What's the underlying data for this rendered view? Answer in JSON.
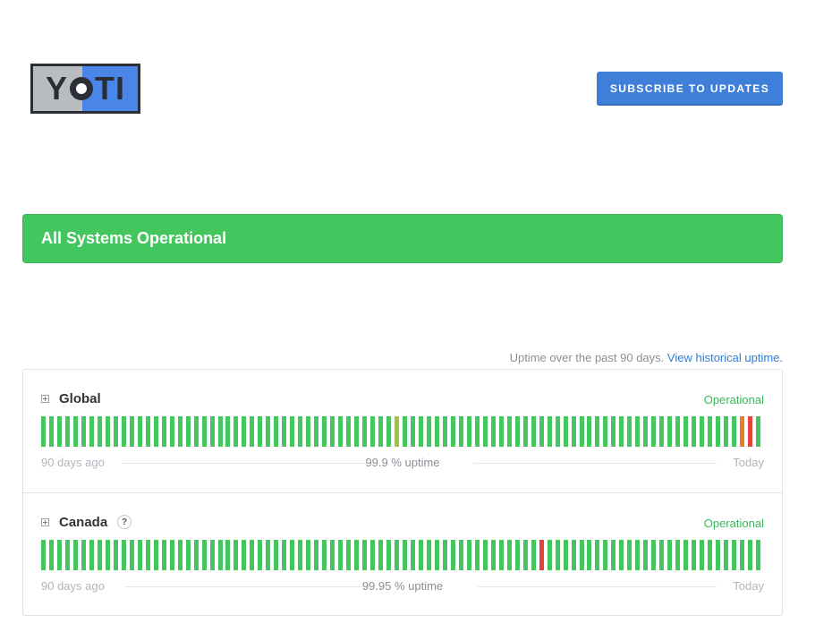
{
  "logo": {
    "text_left": "Y",
    "text_right": "TI",
    "alt": "YOTI"
  },
  "header": {
    "subscribe_label": "SUBSCRIBE TO UPDATES"
  },
  "banner": {
    "text": "All Systems Operational"
  },
  "uptime_note": {
    "text": "Uptime over the past 90 days.",
    "link": "View historical uptime."
  },
  "colors": {
    "operational": "#43c65e",
    "minor": "#a4c03c",
    "partial": "#e67e22",
    "major": "#e0443a",
    "accent": "#3f7fd9"
  },
  "components": [
    {
      "name": "Global",
      "status": "Operational",
      "has_help": false,
      "days_ago_label": "90 days ago",
      "uptime_label": "99.9 % uptime",
      "today_label": "Today",
      "incident_days": {
        "44": "minor",
        "87": "partial",
        "88": "major"
      }
    },
    {
      "name": "Canada",
      "status": "Operational",
      "has_help": true,
      "help_label": "?",
      "days_ago_label": "90 days ago",
      "uptime_label": "99.95 % uptime",
      "today_label": "Today",
      "incident_days": {
        "62": "major"
      }
    }
  ]
}
